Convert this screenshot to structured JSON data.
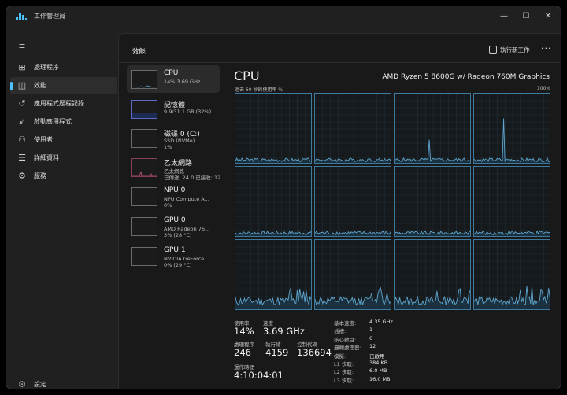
{
  "window": {
    "title": "工作管理員",
    "minimize": "—",
    "maximize": "☐",
    "close": "✕"
  },
  "nav": {
    "menu_icon": "hamburger-icon",
    "items": [
      {
        "label": "處理程序",
        "icon": "processes-icon"
      },
      {
        "label": "效能",
        "icon": "performance-icon",
        "active": true
      },
      {
        "label": "應用程式歷程記錄",
        "icon": "history-icon"
      },
      {
        "label": "啟動應用程式",
        "icon": "startup-icon"
      },
      {
        "label": "使用者",
        "icon": "users-icon"
      },
      {
        "label": "詳細資料",
        "icon": "details-icon"
      },
      {
        "label": "服務",
        "icon": "services-icon"
      }
    ],
    "settings": {
      "label": "設定",
      "icon": "gear-icon"
    }
  },
  "header": {
    "title": "效能",
    "run_task": "執行新工作",
    "more": "···"
  },
  "perf_items": [
    {
      "name": "CPU",
      "sub": "14%  3.69 GHz",
      "sub2": "",
      "active": true,
      "kind": "cpu"
    },
    {
      "name": "記憶體",
      "sub": "9.9/31.1 GB (32%)",
      "sub2": "",
      "kind": "mem",
      "level": 0.32
    },
    {
      "name": "磁碟 0 (C:)",
      "sub": "SSD (NVMe)",
      "sub2": "1%",
      "kind": "disk"
    },
    {
      "name": "乙太網路",
      "sub": "乙太網路",
      "sub2": "已傳送: 24.0 已接收: 12",
      "kind": "net"
    },
    {
      "name": "NPU 0",
      "sub": "NPU Compute A...",
      "sub2": "0%",
      "kind": "npu"
    },
    {
      "name": "GPU 0",
      "sub": "AMD Radeon 76...",
      "sub2": "3% (28 °C)",
      "kind": "gpu"
    },
    {
      "name": "GPU 1",
      "sub": "NVIDIA GeForce ...",
      "sub2": "0% (29 °C)",
      "kind": "gpu"
    }
  ],
  "cpu": {
    "title": "CPU",
    "model": "AMD Ryzen 5 8600G w/ Radeon 760M Graphics",
    "axis_left": "過去 60 秒的使用率 %",
    "axis_right": "100%",
    "stats": {
      "util_label": "使用率",
      "util_value": "14%",
      "speed_label": "速度",
      "speed_value": "3.69 GHz",
      "proc_label": "處理程序",
      "proc_value": "246",
      "threads_label": "執行緒",
      "threads_value": "4159",
      "handles_label": "控制代碼",
      "handles_value": "136694",
      "uptime_label": "運作時間",
      "uptime_value": "4:10:04:01"
    },
    "specs": [
      {
        "k": "基本速度:",
        "v": "4.35 GHz"
      },
      {
        "k": "插槽:",
        "v": "1"
      },
      {
        "k": "核心數目:",
        "v": "6"
      },
      {
        "k": "邏輯處理器:",
        "v": "12"
      },
      {
        "k": "模擬:",
        "v": "已啟用"
      },
      {
        "k": "L1 快取:",
        "v": "384 KB"
      },
      {
        "k": "L2 快取:",
        "v": "6.0 MB"
      },
      {
        "k": "L3 快取:",
        "v": "16.0 MB"
      }
    ]
  },
  "colors": {
    "accent": "#4cc2ff",
    "graph_line": "#5fa6cf",
    "graph_fill": "#1e3a4d",
    "graph_border": "#3e7aa0"
  }
}
